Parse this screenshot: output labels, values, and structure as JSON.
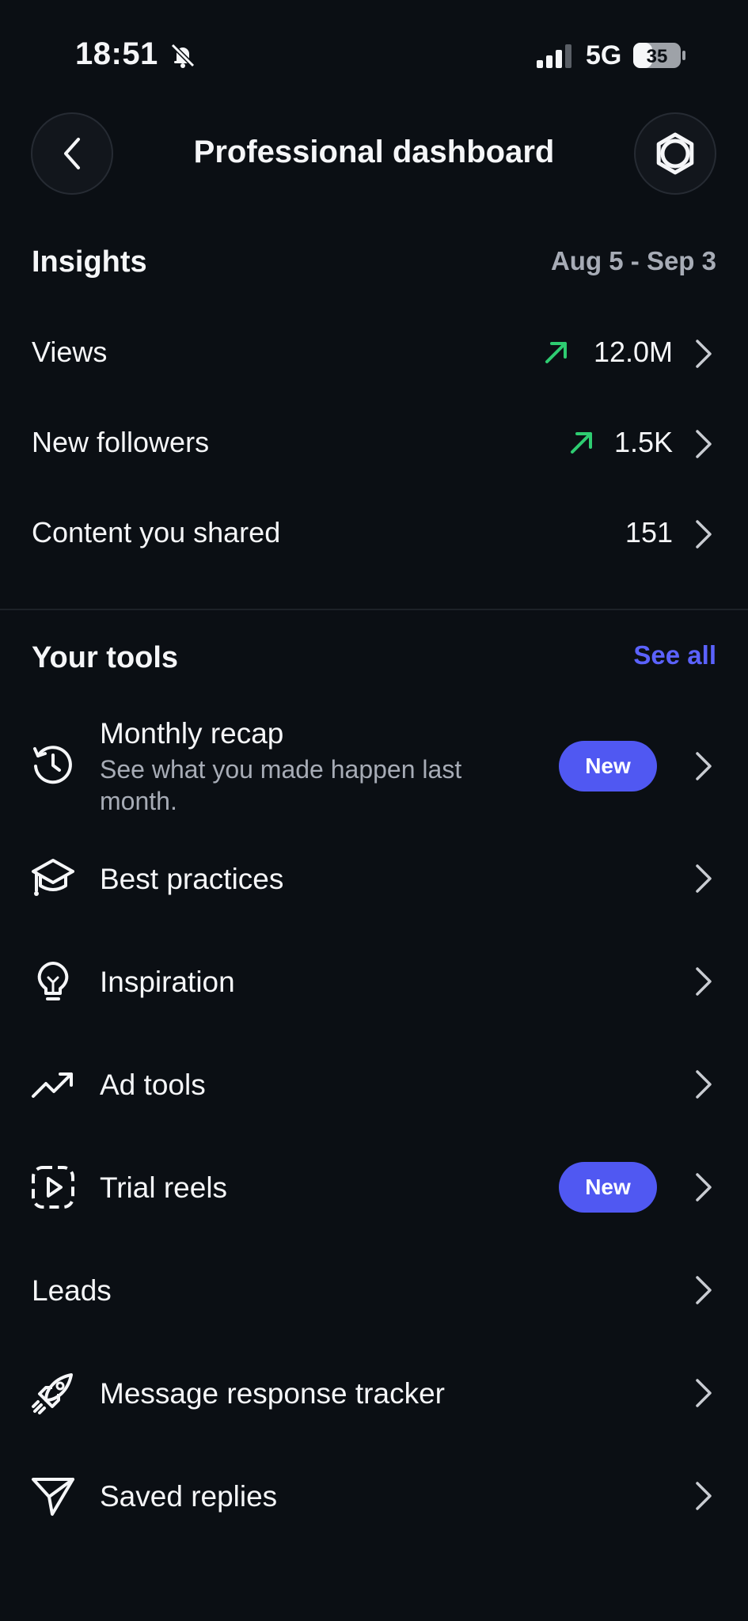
{
  "status_bar": {
    "time": "18:51",
    "network": "5G",
    "battery": "35"
  },
  "header": {
    "title": "Professional dashboard"
  },
  "insights": {
    "heading": "Insights",
    "date_range": "Aug 5 - Sep 3",
    "rows": [
      {
        "label": "Views",
        "value": "12.0M",
        "trend": "up"
      },
      {
        "label": "New followers",
        "value": "1.5K",
        "trend": "up"
      },
      {
        "label": "Content you shared",
        "value": "151",
        "trend": "none"
      }
    ]
  },
  "tools": {
    "heading": "Your tools",
    "see_all": "See all",
    "items": [
      {
        "label": "Monthly recap",
        "subtitle": "See what you made happen last month.",
        "badge": "New",
        "icon": "history-icon"
      },
      {
        "label": "Best practices",
        "icon": "graduation-cap-icon"
      },
      {
        "label": "Inspiration",
        "icon": "lightbulb-icon"
      },
      {
        "label": "Ad tools",
        "icon": "trending-up-icon"
      },
      {
        "label": "Trial reels",
        "badge": "New",
        "icon": "reel-play-icon"
      },
      {
        "label": "Leads"
      },
      {
        "label": "Message response tracker",
        "icon": "rocket-icon"
      },
      {
        "label": "Saved replies",
        "icon": "send-icon"
      }
    ]
  },
  "colors": {
    "background": "#0b0f14",
    "accent": "#5b62ff",
    "badge": "#5058f2",
    "trend_up": "#2ecc71",
    "muted": "#a7acb6"
  }
}
